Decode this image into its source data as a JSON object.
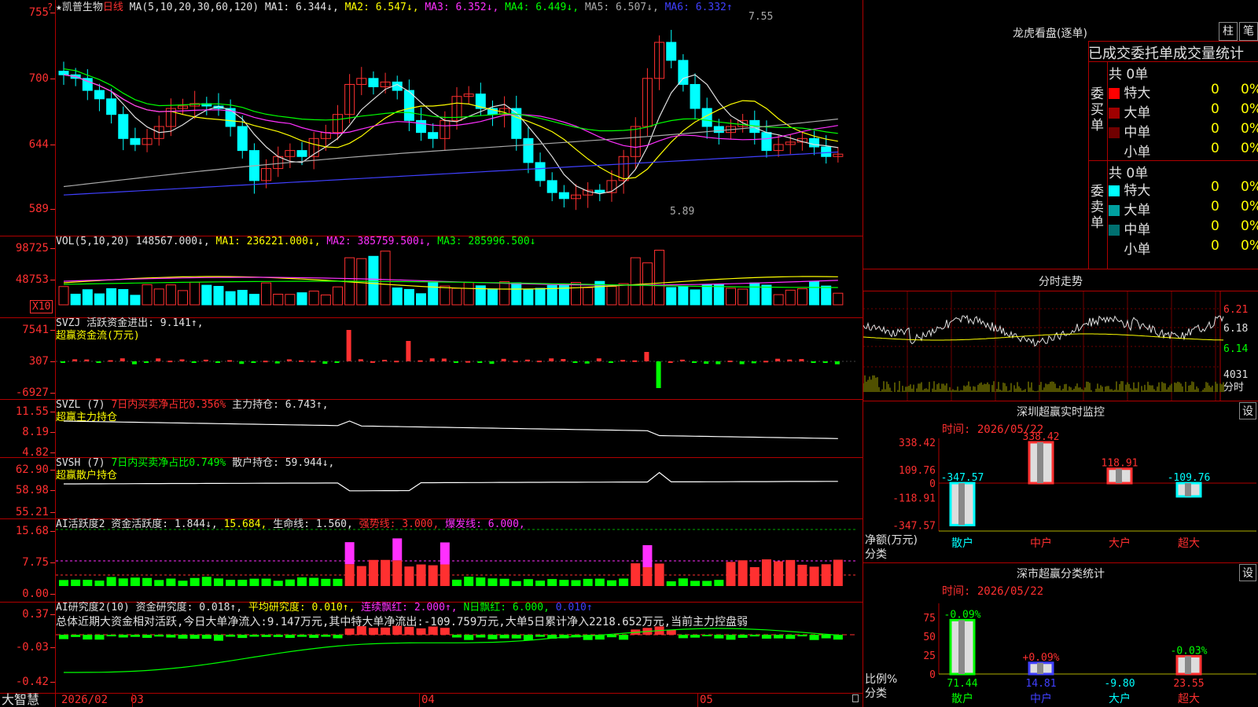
{
  "stock": {
    "name": "★凯普生物",
    "period": "日线"
  },
  "ma_legend": [
    {
      "label": "MA(5,10,20,30,60,120)",
      "color": "#e0e0e0"
    },
    {
      "label": "MA1: 6.344↓,",
      "color": "#e0e0e0"
    },
    {
      "label": "MA2: 6.547↓,",
      "color": "#ffff00"
    },
    {
      "label": "MA3: 6.352↓,",
      "color": "#ff30ff"
    },
    {
      "label": "MA4: 6.449↓,",
      "color": "#00ff00"
    },
    {
      "label": "MA5: 6.507↓,",
      "color": "#aaaaaa"
    },
    {
      "label": "MA6: 6.332↑",
      "color": "#4040ff"
    }
  ],
  "price_axis": [
    "755",
    "700",
    "644",
    "589"
  ],
  "price_marks": {
    "high": "7.55",
    "low": "5.89"
  },
  "vol_legend": [
    {
      "label": "VOL(5,10,20)",
      "color": "#e0e0e0"
    },
    {
      "label": "148567.000↓,",
      "color": "#e0e0e0"
    },
    {
      "label": "MA1: 236221.000↓,",
      "color": "#ffff00"
    },
    {
      "label": "MA2: 385759.500↓,",
      "color": "#ff30ff"
    },
    {
      "label": "MA3: 285996.500↓",
      "color": "#00ff00"
    }
  ],
  "vol_axis": [
    "98725",
    "48753"
  ],
  "vol_unit": "X10",
  "svzj": {
    "line1": "SVZJ  活跃资金进出: 9.141↑,",
    "line2": "超赢资金流(万元)",
    "axis": [
      "7541",
      "307",
      "-6927"
    ]
  },
  "svzl": {
    "pre": "SVZL (7)",
    "mid": "7日内买卖净占比0.356%",
    "post": "主力持仓: 6.743↑,",
    "line2": "超赢主力持仓",
    "axis": [
      "11.55",
      "8.19",
      "4.82"
    ]
  },
  "svsh": {
    "pre": "SVSH (7)",
    "mid": "7日内买卖净占比0.749%",
    "post": "散户持仓: 59.944↓,",
    "line2": "超赢散户持仓",
    "axis": [
      "62.90",
      "58.98",
      "55.21"
    ]
  },
  "ai_active": {
    "items": [
      {
        "label": "AI活跃度2 资金活跃度: 1.844↓,",
        "color": "#e0e0e0"
      },
      {
        "label": "15.684,",
        "color": "#ffff00"
      },
      {
        "label": "生命线: 1.560,",
        "color": "#e0e0e0"
      },
      {
        "label": "强势线: 3.000,",
        "color": "#ff3030"
      },
      {
        "label": "爆发线: 6.000,",
        "color": "#ff30ff"
      }
    ],
    "axis": [
      "15.68",
      "7.75",
      "0.00"
    ]
  },
  "ai_research": {
    "items": [
      {
        "label": "AI研究度2(10) 资金研究度: 0.018↑,",
        "color": "#e0e0e0"
      },
      {
        "label": "平均研究度: 0.010↑,",
        "color": "#ffff00"
      },
      {
        "label": "连续飘红: 2.000↑,",
        "color": "#ff30ff"
      },
      {
        "label": "N日飘红: 6.000,",
        "color": "#00ff00"
      },
      {
        "label": "0.010↑",
        "color": "#4040ff"
      }
    ],
    "summary": "总体近期大资金相对活跃,今日大单净流入:9.147万元,其中特大单净流出:-109.759万元,大单5日累计净入2218.652万元,当前主力控盘弱",
    "axis": [
      "0.37",
      "-0.03",
      "-0.42"
    ]
  },
  "bottom_axis": {
    "brand": "大智慧",
    "labels": [
      "2026/02",
      "03",
      "04",
      "05"
    ]
  },
  "dragon": {
    "title": "龙虎看盘(逐单)",
    "btn_zhu": "柱",
    "btn_bi": "笔",
    "subtitle": "已成交委托单成交量统计",
    "buy_label": "委买单",
    "sell_label": "委卖单",
    "buy_total": "共 0单",
    "sell_total": "共 0单",
    "buy_rows": [
      {
        "name": "特大",
        "val": "0",
        "pct": "0%",
        "color": "#ff0000"
      },
      {
        "name": "大单",
        "val": "0",
        "pct": "0%",
        "color": "#a00000"
      },
      {
        "name": "中单",
        "val": "0",
        "pct": "0%",
        "color": "#700000"
      },
      {
        "name": "小单",
        "val": "0",
        "pct": "0%",
        "color": ""
      }
    ],
    "sell_rows": [
      {
        "name": "特大",
        "val": "0",
        "pct": "0%",
        "color": "#00ffff"
      },
      {
        "name": "大单",
        "val": "0",
        "pct": "0%",
        "color": "#00a0a0"
      },
      {
        "name": "中单",
        "val": "0",
        "pct": "0%",
        "color": "#007070"
      },
      {
        "name": "小单",
        "val": "0",
        "pct": "0%",
        "color": ""
      }
    ]
  },
  "intraday": {
    "title": "分时走势",
    "axis": [
      "6.21",
      "6.18",
      "6.14"
    ],
    "vol": "4031",
    "vol_label": "分时"
  },
  "sz_monitor": {
    "title": "深圳超赢实时监控",
    "set": "设",
    "time": "时间: 2026/05/22",
    "axis": [
      "338.42",
      "109.76",
      "0",
      "-118.91",
      "-347.57"
    ],
    "ylabel1": "净额(万元)",
    "ylabel2": "分类",
    "bars": [
      {
        "cat": "散户",
        "value": -347.57,
        "label": "-347.57"
      },
      {
        "cat": "中户",
        "value": 338.42,
        "label": "338.42"
      },
      {
        "cat": "大户",
        "value": 118.91,
        "label": "118.91"
      },
      {
        "cat": "超大",
        "value": -109.76,
        "label": "-109.76"
      }
    ]
  },
  "sz_class": {
    "title": "深市超赢分类统计",
    "set": "设",
    "time": "时间: 2026/05/22",
    "axis": [
      "75",
      "50",
      "25",
      "0"
    ],
    "ylabel1": "比例%",
    "ylabel2": "分类",
    "bars": [
      {
        "cat": "散户",
        "value": 71.44,
        "val_label": "71.44",
        "top_label": "-0.09%"
      },
      {
        "cat": "中户",
        "value": 14.81,
        "val_label": "14.81",
        "top_label": "+0.09%"
      },
      {
        "cat": "大户",
        "value": -9.8,
        "val_label": "-9.80",
        "top_label": ""
      },
      {
        "cat": "超大",
        "value": 23.55,
        "val_label": "23.55",
        "top_label": "-0.03%"
      }
    ]
  },
  "chart_data": {
    "type": "bar",
    "title": "",
    "categories": [
      "散户",
      "中户",
      "大户",
      "超大"
    ],
    "series": [
      {
        "name": "净额(万元)",
        "values": [
          -347.57,
          338.42,
          118.91,
          -109.76
        ]
      }
    ],
    "ylim": [
      -347.57,
      338.42
    ]
  }
}
